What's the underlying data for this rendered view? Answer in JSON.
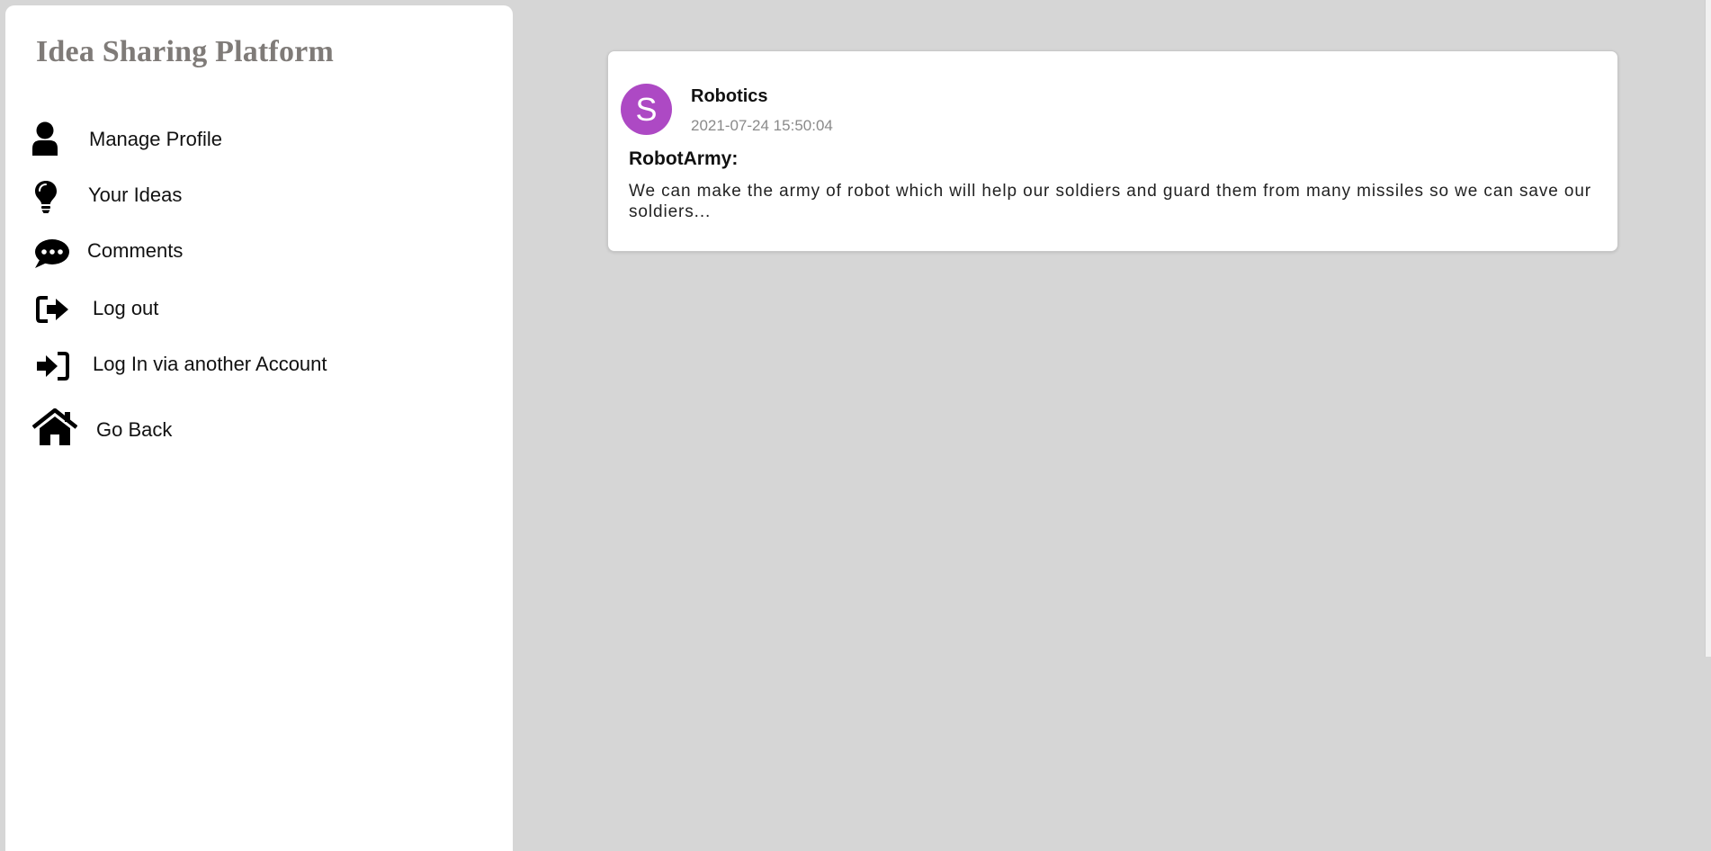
{
  "app": {
    "title": "Idea Sharing Platform"
  },
  "sidebar": {
    "items": [
      {
        "label": "Manage Profile",
        "icon": "user-icon"
      },
      {
        "label": "Your Ideas",
        "icon": "lightbulb-icon"
      },
      {
        "label": "Comments",
        "icon": "comment-dots-icon"
      },
      {
        "label": "Log out",
        "icon": "sign-out-icon"
      },
      {
        "label": "Log In via another Account",
        "icon": "sign-in-icon"
      },
      {
        "label": "Go Back",
        "icon": "home-icon"
      }
    ]
  },
  "ideas": [
    {
      "avatar_letter": "S",
      "avatar_color": "#ad49c4",
      "category": "Robotics",
      "date": "2021-07-24 15:50:04",
      "title": "RobotArmy:",
      "body": "We can make the army of robot which will help our soldiers and guard them from many missiles so we can save our soldiers..."
    }
  ],
  "colors": {
    "background": "#d6d6d6",
    "sidebar": "#ffffff",
    "title": "#7f7b78"
  }
}
